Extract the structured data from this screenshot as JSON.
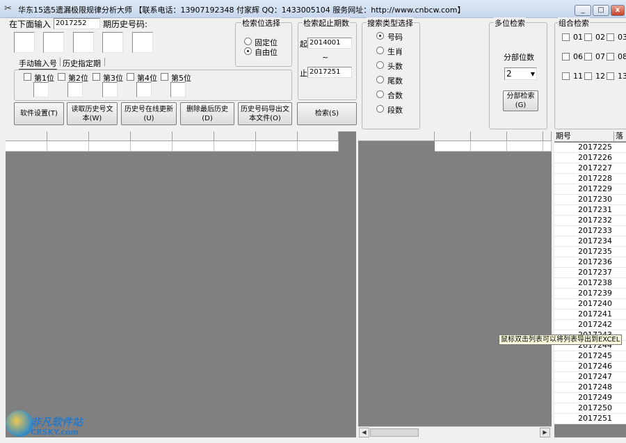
{
  "window": {
    "title": "华东15选5遗漏极限规律分析大师 【联系电话：13907192348 付家辉 QQ：1433005104 服务网址：http://www.cnbcw.com】",
    "minimize": "_",
    "maximize": "□",
    "close": "x"
  },
  "input": {
    "prefix": "在下面输入",
    "issue_value": "2017252",
    "suffix": "期历史号码:",
    "tabs": [
      "手动输入号",
      "历史指定期"
    ],
    "positions": [
      "第1位",
      "第2位",
      "第3位",
      "第4位",
      "第5位"
    ]
  },
  "buttons": {
    "settings": "软件设置(T)",
    "read_history": "读取历史号文本(W)",
    "update_online": "历史号在线更新(U)",
    "delete_last": "删除最后历史(D)",
    "export_text": "历史号码导出文本文件(O)",
    "search": "检索(S)",
    "split_search": "分部检索(G)"
  },
  "position_select": {
    "title": "检索位选择",
    "options": [
      "固定位",
      "自由位"
    ],
    "selected": "自由位"
  },
  "period_range": {
    "title": "检索起止期数",
    "start_label": "起",
    "start_value": "2014001",
    "tilde": "~",
    "end_label": "止",
    "end_value": "2017251"
  },
  "search_type": {
    "title": "搜索类型选择",
    "options": [
      "号码",
      "生肖",
      "头数",
      "尾数",
      "合数",
      "段数"
    ],
    "selected": "号码"
  },
  "multi_search": {
    "title": "多位检索",
    "split_label": "分部位数",
    "split_value": "2"
  },
  "combo_search": {
    "title": "组合检索",
    "numbers": [
      "01",
      "02",
      "03",
      "06",
      "07",
      "08",
      "11",
      "12",
      "13"
    ]
  },
  "issue_list": {
    "header_issue": "期号",
    "header_second": "落",
    "issues": [
      "2017225",
      "2017226",
      "2017227",
      "2017228",
      "2017229",
      "2017230",
      "2017231",
      "2017232",
      "2017233",
      "2017234",
      "2017235",
      "2017236",
      "2017237",
      "2017238",
      "2017239",
      "2017240",
      "2017241",
      "2017242",
      "2017243",
      "2017244",
      "2017245",
      "2017246",
      "2017247",
      "2017248",
      "2017249",
      "2017250",
      "2017251"
    ]
  },
  "tooltip": "鼠标双击列表可以将列表导出到EXCEL",
  "watermark": {
    "line1": "非凡软件站",
    "line2": "CRSKY.com"
  }
}
